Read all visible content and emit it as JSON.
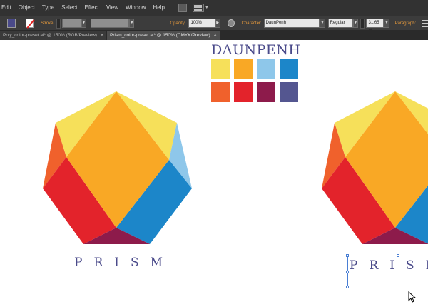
{
  "menu": {
    "items": [
      "Edit",
      "Object",
      "Type",
      "Select",
      "Effect",
      "View",
      "Window",
      "Help"
    ]
  },
  "control_bar": {
    "stroke_label": "Stroke:",
    "opacity_label": "Opacity:",
    "opacity_value": "100%",
    "character_label": "Character:",
    "font_family": "DaunPenh",
    "font_style": "Regular",
    "font_size": "31.65 pt",
    "paragraph_label": "Paragraph:"
  },
  "tabs": [
    {
      "label": "Poly_color-preset.ai* @ 150% (RGB/Preview)",
      "active": false
    },
    {
      "label": "Prism_color-preset.ai* @ 150% (CMYK/Preview)",
      "active": true
    }
  ],
  "canvas": {
    "brand_title": "DAUNPENH",
    "palette": [
      "#f6e05a",
      "#f9a825",
      "#8ec7ea",
      "#1c86c9",
      "#f0612c",
      "#e3232b",
      "#8d1b4b",
      "#545690"
    ],
    "logo_left_text": "PRISM",
    "logo_right_text": "PRISM"
  },
  "colors": {
    "fill_swatch": "#4a4a8a",
    "yellow": "#f6e05a",
    "orange": "#f9a825",
    "light_blue": "#8ec7ea",
    "blue": "#1c86c9",
    "dark_orange": "#f0612c",
    "red": "#e3232b",
    "maroon": "#8d1b4b",
    "text_navy": "#4a4a8a"
  }
}
